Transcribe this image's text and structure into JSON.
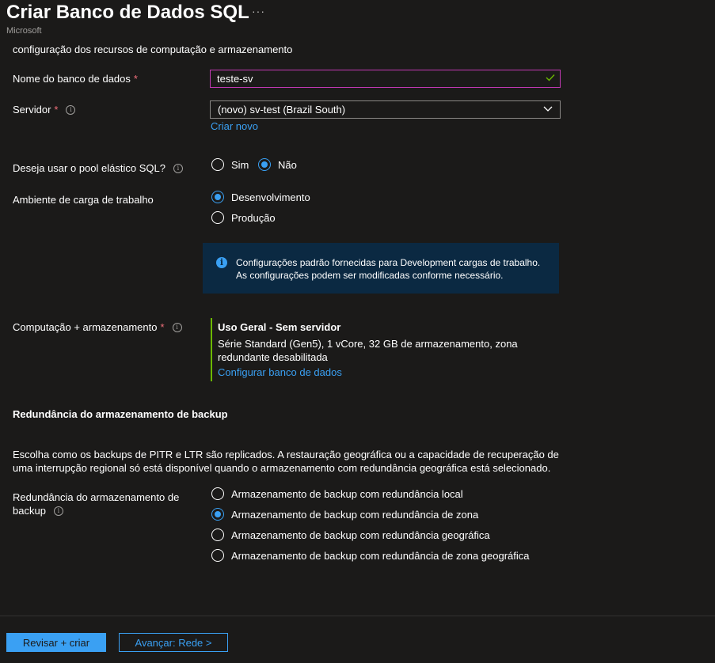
{
  "header": {
    "title": "Criar Banco de Dados SQL",
    "more_icon": "···",
    "publisher": "Microsoft"
  },
  "intro": "configuração dos recursos de computação e armazenamento",
  "database_name": {
    "label": "Nome do banco de dados",
    "required_mark": "*",
    "value": "teste-sv"
  },
  "server": {
    "label": "Servidor",
    "required_mark": "*",
    "value": "(novo) sv-test (Brazil South)",
    "create_new": "Criar novo"
  },
  "elastic_pool": {
    "label": "Deseja usar o pool elástico SQL?",
    "options": [
      "Sim",
      "Não"
    ],
    "selected": "Não"
  },
  "workload": {
    "label": "Ambiente de carga de trabalho",
    "options": [
      "Desenvolvimento",
      "Produção"
    ],
    "selected": "Desenvolvimento",
    "info_line1": "Configurações padrão fornecidas para Development cargas de trabalho.",
    "info_line2": "As configurações podem ser modificadas conforme necessário."
  },
  "compute": {
    "label": "Computação + armazenamento",
    "required_mark": "*",
    "tier": "Uso Geral - Sem servidor",
    "details_line1": "Série Standard (Gen5), 1 vCore, 32 GB de armazenamento, zona",
    "details_line2": "redundante desabilitada",
    "configure_link": "Configurar banco de dados"
  },
  "backup": {
    "section_title": "Redundância do armazenamento de backup",
    "description_line1": "Escolha como os backups de PITR e LTR são replicados. A restauração geográfica ou a capacidade de recuperação de",
    "description_line2": "uma interrupção regional só está disponível quando o armazenamento com redundância geográfica está selecionado.",
    "label_line1": "Redundância do armazenamento de",
    "label_line2": "backup",
    "options": [
      "Armazenamento de backup com redundância local",
      "Armazenamento de backup com redundância de zona",
      "Armazenamento de backup com redundância geográfica",
      "Armazenamento de backup com redundância de zona geográfica"
    ],
    "selected_index": 1
  },
  "footer": {
    "review_create": "Revisar + criar",
    "next": "Avançar: Rede >"
  },
  "colors": {
    "accent": "#3aa0f3",
    "required": "#f1707b",
    "focus_border": "#c239b3",
    "success_check": "#6bb700",
    "info_bg": "#0b2942",
    "background": "#1b1a19"
  }
}
